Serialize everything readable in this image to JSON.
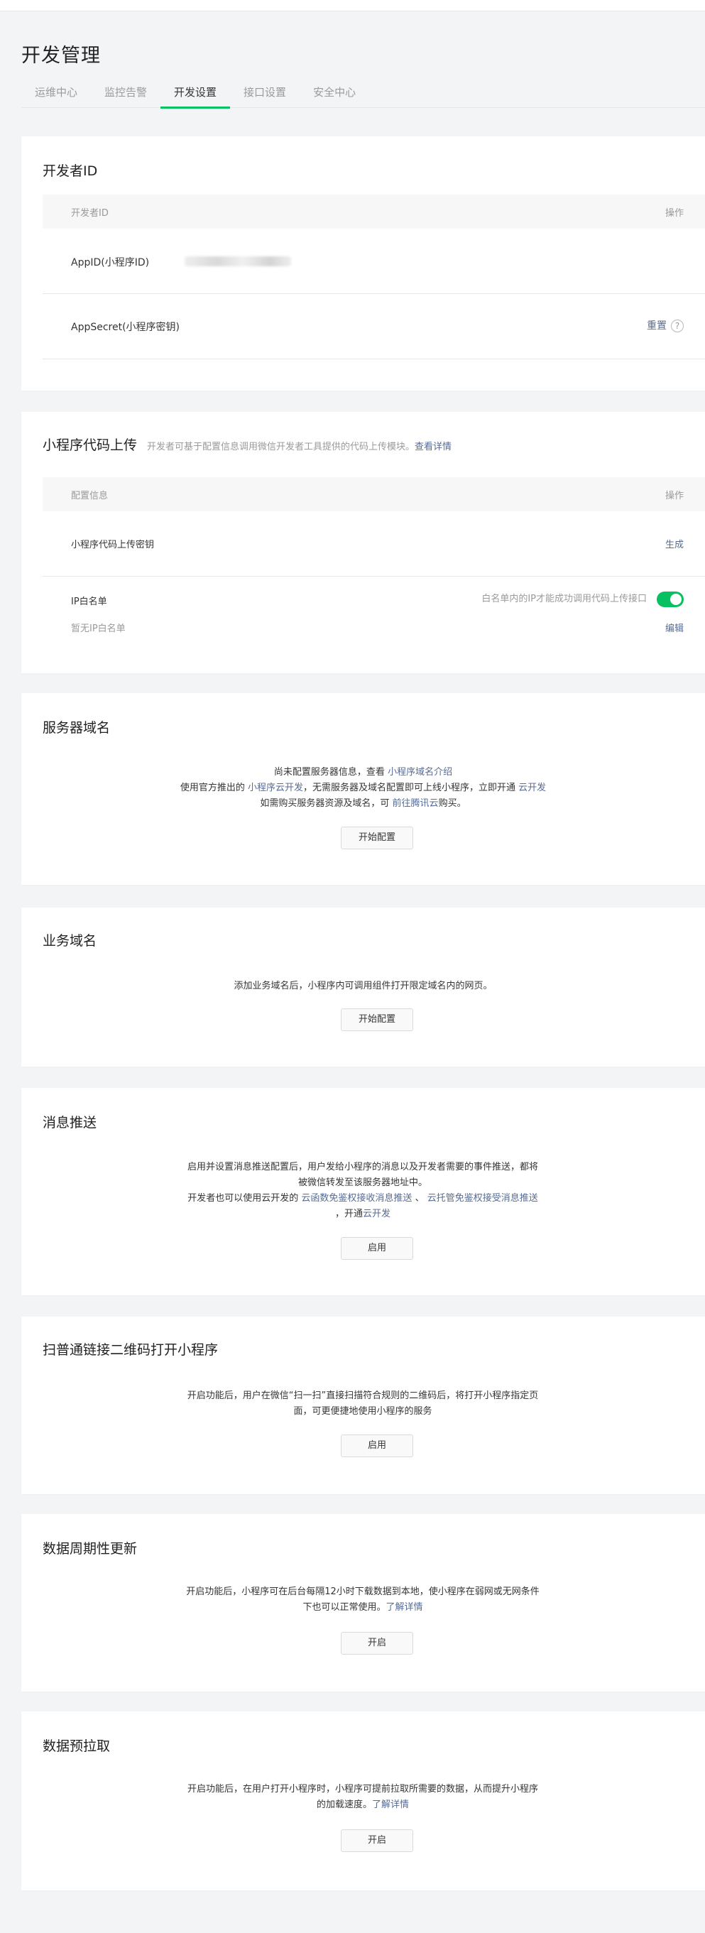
{
  "page": {
    "title": "开发管理"
  },
  "tabs": [
    {
      "label": "运维中心"
    },
    {
      "label": "监控告警"
    },
    {
      "label": "开发设置",
      "active": true
    },
    {
      "label": "接口设置"
    },
    {
      "label": "安全中心"
    }
  ],
  "developer_id": {
    "title": "开发者ID",
    "col_left": "开发者ID",
    "col_right": "操作",
    "rows": [
      {
        "label": "AppID(小程序ID)"
      },
      {
        "label": "AppSecret(小程序密钥)",
        "action": "重置"
      }
    ]
  },
  "code_upload": {
    "title": "小程序代码上传",
    "desc": "开发者可基于配置信息调用微信开发者工具提供的代码上传模块。",
    "desc_link": "查看详情",
    "col_left": "配置信息",
    "col_right": "操作",
    "key_row": {
      "label": "小程序代码上传密钥",
      "action": "生成"
    },
    "ip_row": {
      "label": "IP白名单",
      "hint": "白名单内的IP才能成功调用代码上传接口",
      "toggle_on": true,
      "empty": "暂无IP白名单",
      "action": "编辑"
    }
  },
  "server_domain": {
    "title": "服务器域名",
    "line1_text": "尚未配置服务器信息，查看 ",
    "line1_link": "小程序域名介绍",
    "line2_text_a": "使用官方推出的 ",
    "line2_link_a": "小程序云开发",
    "line2_text_b": "，无需服务器及域名配置即可上线小程序，立即开通 ",
    "line2_link_b": "云开发",
    "line3_text_a": "如需购买服务器资源及域名，可 ",
    "line3_link": "前往腾讯云",
    "line3_text_b": "购买。",
    "button": "开始配置"
  },
  "business_domain": {
    "title": "业务域名",
    "text": "添加业务域名后，小程序内可调用组件打开限定域名内的网页。",
    "button": "开始配置"
  },
  "message_push": {
    "title": "消息推送",
    "text_a": "启用并设置消息推送配置后，用户发给小程序的消息以及开发者需要的事件推送，都将被微信转发至该服务器地址中。",
    "text_b": "开发者也可以使用云开发的 ",
    "link_a": "云函数免鉴权接收消息推送",
    "text_c": " 、 ",
    "link_b": "云托管免鉴权接受消息推送",
    "text_d": " ，开通",
    "link_c": "云开发",
    "button": "启用"
  },
  "qrcode_open": {
    "title": "扫普通链接二维码打开小程序",
    "text": "开启功能后，用户在微信“扫一扫”直接扫描符合规则的二维码后，将打开小程序指定页面，可更便捷地使用小程序的服务",
    "button": "启用"
  },
  "periodic_update": {
    "title": "数据周期性更新",
    "text": "开启功能后，小程序可在后台每隔12小时下载数据到本地，使小程序在弱网或无网条件下也可以正常使用。",
    "link": "了解详情",
    "button": "开启"
  },
  "prefetch": {
    "title": "数据预拉取",
    "text": "开启功能后，在用户打开小程序时，小程序可提前拉取所需要的数据，从而提升小程序的加载速度。",
    "link": "了解详情",
    "button": "开启"
  },
  "colors": {
    "accent": "#07c160",
    "link": "#576b95"
  }
}
